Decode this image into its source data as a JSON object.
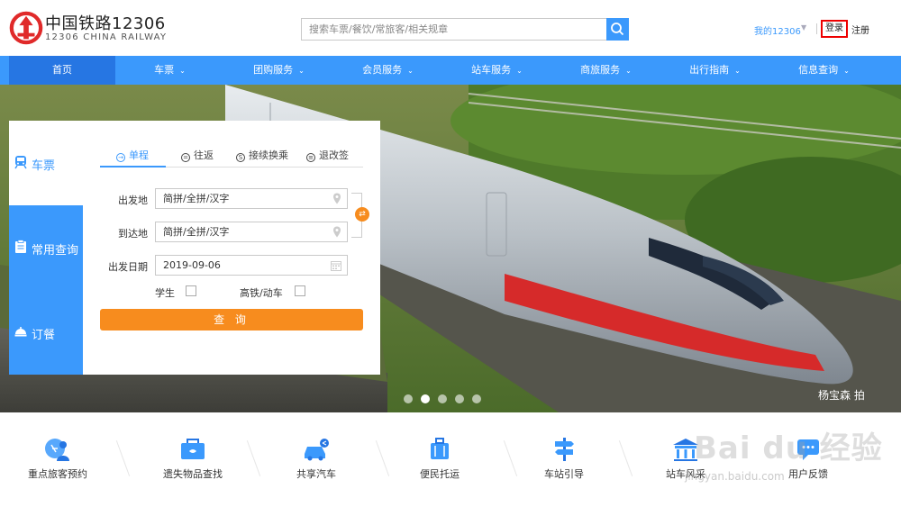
{
  "header": {
    "brand_cn": "中国铁路12306",
    "brand_en": "12306 CHINA RAILWAY",
    "search_placeholder": "搜索车票/餐饮/常旅客/相关规章",
    "my12306": "我的12306",
    "login": "登录",
    "register": "注册"
  },
  "nav": {
    "items": [
      {
        "label": "首页",
        "has_caret": false
      },
      {
        "label": "车票",
        "has_caret": true
      },
      {
        "label": "团购服务",
        "has_caret": true
      },
      {
        "label": "会员服务",
        "has_caret": true
      },
      {
        "label": "站车服务",
        "has_caret": true
      },
      {
        "label": "商旅服务",
        "has_caret": true
      },
      {
        "label": "出行指南",
        "has_caret": true
      },
      {
        "label": "信息查询",
        "has_caret": true
      }
    ],
    "caret": "⌄"
  },
  "banner": {
    "photo_credit": "杨宝森  拍",
    "slide_count": 5,
    "active_slide": 2
  },
  "booking": {
    "side_tabs": [
      {
        "label": "车票",
        "icon": "train-icon"
      },
      {
        "label": "常用查询",
        "icon": "clipboard-icon"
      },
      {
        "label": "订餐",
        "icon": "meal-icon"
      }
    ],
    "trip_tabs": [
      {
        "label": "单程",
        "glyph": "→"
      },
      {
        "label": "往返",
        "glyph": "="
      },
      {
        "label": "接续换乘",
        "glyph": "S"
      },
      {
        "label": "退改签",
        "glyph": "≡"
      }
    ],
    "from_label": "出发地",
    "from_placeholder": "简拼/全拼/汉字",
    "to_label": "到达地",
    "to_placeholder": "简拼/全拼/汉字",
    "date_label": "出发日期",
    "date_value": "2019-09-06",
    "student_label": "学生",
    "highspeed_label": "高铁/动车",
    "query_label": "查 询"
  },
  "services": [
    {
      "label": "重点旅客预约",
      "icon": "accessibility-icon"
    },
    {
      "label": "遗失物品查找",
      "icon": "lost-found-icon"
    },
    {
      "label": "共享汽车",
      "icon": "car-share-icon"
    },
    {
      "label": "便民托运",
      "icon": "luggage-icon"
    },
    {
      "label": "车站引导",
      "icon": "signpost-icon"
    },
    {
      "label": "站车风采",
      "icon": "station-icon"
    },
    {
      "label": "用户反馈",
      "icon": "feedback-icon"
    }
  ],
  "colors": {
    "primary": "#3b99fc",
    "nav_active": "#2676e3",
    "accent": "#f78c1e",
    "logo_red": "#e02a2a",
    "highlight_border": "#ee0000"
  },
  "watermark": {
    "text": "Bai du 经验",
    "sub": "jingyan.baidu.com"
  }
}
